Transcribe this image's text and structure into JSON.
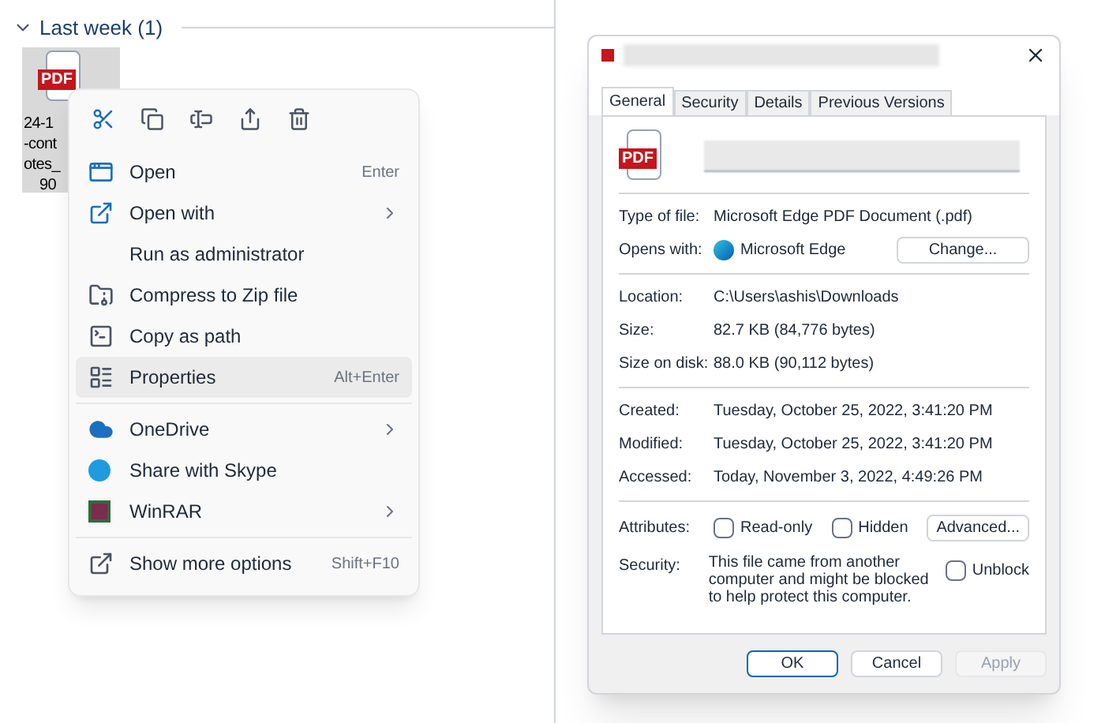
{
  "explorer": {
    "group": {
      "label": "Last week (1)",
      "expanded": true
    },
    "file": {
      "badge": "PDF",
      "name_lines": [
        "24-1",
        "-cont",
        "otes_",
        "90"
      ]
    }
  },
  "context_menu": {
    "groups": [
      [
        {
          "label": "Open",
          "shortcut": "Enter",
          "submenu": false,
          "selected": false
        },
        {
          "label": "Open with",
          "submenu": true,
          "selected": false
        },
        {
          "label": "Run as administrator",
          "submenu": false,
          "selected": false
        },
        {
          "label": "Compress to Zip file",
          "submenu": false,
          "selected": false
        },
        {
          "label": "Copy as path",
          "submenu": false,
          "selected": false
        },
        {
          "label": "Properties",
          "shortcut": "Alt+Enter",
          "submenu": false,
          "selected": true
        }
      ],
      [
        {
          "label": "OneDrive",
          "submenu": true,
          "selected": false
        },
        {
          "label": "Share with Skype",
          "submenu": false,
          "selected": false
        },
        {
          "label": "WinRAR",
          "submenu": true,
          "selected": false
        }
      ],
      [
        {
          "label": "Show more options",
          "shortcut": "Shift+F10",
          "submenu": false,
          "selected": false
        }
      ]
    ]
  },
  "dialog": {
    "tabs": [
      {
        "label": "General",
        "selected": true
      },
      {
        "label": "Security",
        "selected": false
      },
      {
        "label": "Details",
        "selected": false
      },
      {
        "label": "Previous Versions",
        "selected": false
      }
    ],
    "file_badge": "PDF",
    "sections": [
      [
        {
          "label": "Type of file:",
          "value": "Microsoft Edge PDF Document (.pdf)"
        },
        {
          "label": "Opens with:",
          "value": "Microsoft Edge",
          "button": "Change..."
        }
      ],
      [
        {
          "label": "Location:",
          "value": "C:\\Users\\ashis\\Downloads"
        },
        {
          "label": "Size:",
          "value": "82.7 KB (84,776 bytes)"
        },
        {
          "label": "Size on disk:",
          "value": "88.0 KB (90,112 bytes)"
        }
      ],
      [
        {
          "label": "Created:",
          "value": "Tuesday, October 25, 2022, 3:41:20 PM"
        },
        {
          "label": "Modified:",
          "value": "Tuesday, October 25, 2022, 3:41:20 PM"
        },
        {
          "label": "Accessed:",
          "value": "Today, November 3, 2022, 4:49:26 PM"
        }
      ]
    ],
    "attributes": {
      "label": "Attributes:",
      "checkboxes": [
        {
          "label": "Read-only",
          "checked": false
        },
        {
          "label": "Hidden",
          "checked": false
        }
      ],
      "button": "Advanced..."
    },
    "security": {
      "label": "Security:",
      "text": "This file came from another computer and might be blocked to help protect this computer.",
      "checkbox": {
        "label": "Unblock",
        "checked": false
      }
    },
    "buttons": [
      {
        "label": "OK",
        "disabled": false,
        "default": true
      },
      {
        "label": "Cancel",
        "disabled": false,
        "default": false
      },
      {
        "label": "Apply",
        "disabled": true,
        "default": false
      }
    ]
  }
}
